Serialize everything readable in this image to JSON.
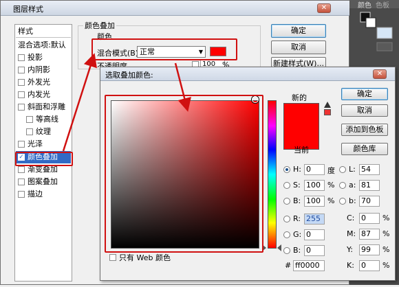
{
  "layer_style": {
    "title": "图层样式",
    "list_header": "样式",
    "items": [
      {
        "label": "混合选项:默认",
        "checkbox": false,
        "indent": 0
      },
      {
        "label": "投影",
        "checkbox": true,
        "indent": 0
      },
      {
        "label": "内阴影",
        "checkbox": true,
        "indent": 0
      },
      {
        "label": "外发光",
        "checkbox": true,
        "indent": 0
      },
      {
        "label": "内发光",
        "checkbox": true,
        "indent": 0
      },
      {
        "label": "斜面和浮雕",
        "checkbox": true,
        "indent": 0
      },
      {
        "label": "等高线",
        "checkbox": true,
        "indent": 1
      },
      {
        "label": "纹理",
        "checkbox": true,
        "indent": 1
      },
      {
        "label": "光泽",
        "checkbox": true,
        "indent": 0
      },
      {
        "label": "颜色叠加",
        "checkbox": true,
        "indent": 0,
        "selected": true
      },
      {
        "label": "渐变叠加",
        "checkbox": true,
        "indent": 0
      },
      {
        "label": "图案叠加",
        "checkbox": true,
        "indent": 0
      },
      {
        "label": "描边",
        "checkbox": true,
        "indent": 0
      }
    ],
    "group_title": "颜色叠加",
    "sub_group_title": "颜色",
    "blend_mode_label": "混合模式(B):",
    "blend_mode_value": "正常",
    "opacity_label": "不透明度",
    "opacity_value": "100",
    "opacity_unit": "%",
    "ok_label": "确定",
    "cancel_label": "取消",
    "new_style_label": "新建样式(W)...",
    "overlay_color": "#ff0000"
  },
  "ps_panel": {
    "tab1": "颜色",
    "tab2": "色板"
  },
  "color_picker": {
    "title": "选取叠加颜色:",
    "new_label": "新的",
    "current_label": "当前",
    "new_color": "#ff0000",
    "current_color": "#ff0000",
    "ok_label": "确定",
    "cancel_label": "取消",
    "add_swatch_label": "添加到色板",
    "color_library_label": "颜色库",
    "web_only_label": "只有 Web 颜色",
    "hsb": [
      {
        "label": "H:",
        "value": "0",
        "unit": "度",
        "selected": true
      },
      {
        "label": "S:",
        "value": "100",
        "unit": "%",
        "selected": false
      },
      {
        "label": "B:",
        "value": "100",
        "unit": "%",
        "selected": false
      }
    ],
    "rgb": [
      {
        "label": "R:",
        "value": "255",
        "selected": false
      },
      {
        "label": "G:",
        "value": "0",
        "selected": false
      },
      {
        "label": "B:",
        "value": "0",
        "selected": false
      }
    ],
    "lab": [
      {
        "label": "L:",
        "value": "54"
      },
      {
        "label": "a:",
        "value": "81"
      },
      {
        "label": "b:",
        "value": "70"
      }
    ],
    "cmyk": [
      {
        "label": "C:",
        "value": "0",
        "unit": "%"
      },
      {
        "label": "M:",
        "value": "87",
        "unit": "%"
      },
      {
        "label": "Y:",
        "value": "99",
        "unit": "%"
      },
      {
        "label": "K:",
        "value": "0",
        "unit": "%"
      }
    ],
    "hex_label": "#",
    "hex_value": "ff0000"
  }
}
